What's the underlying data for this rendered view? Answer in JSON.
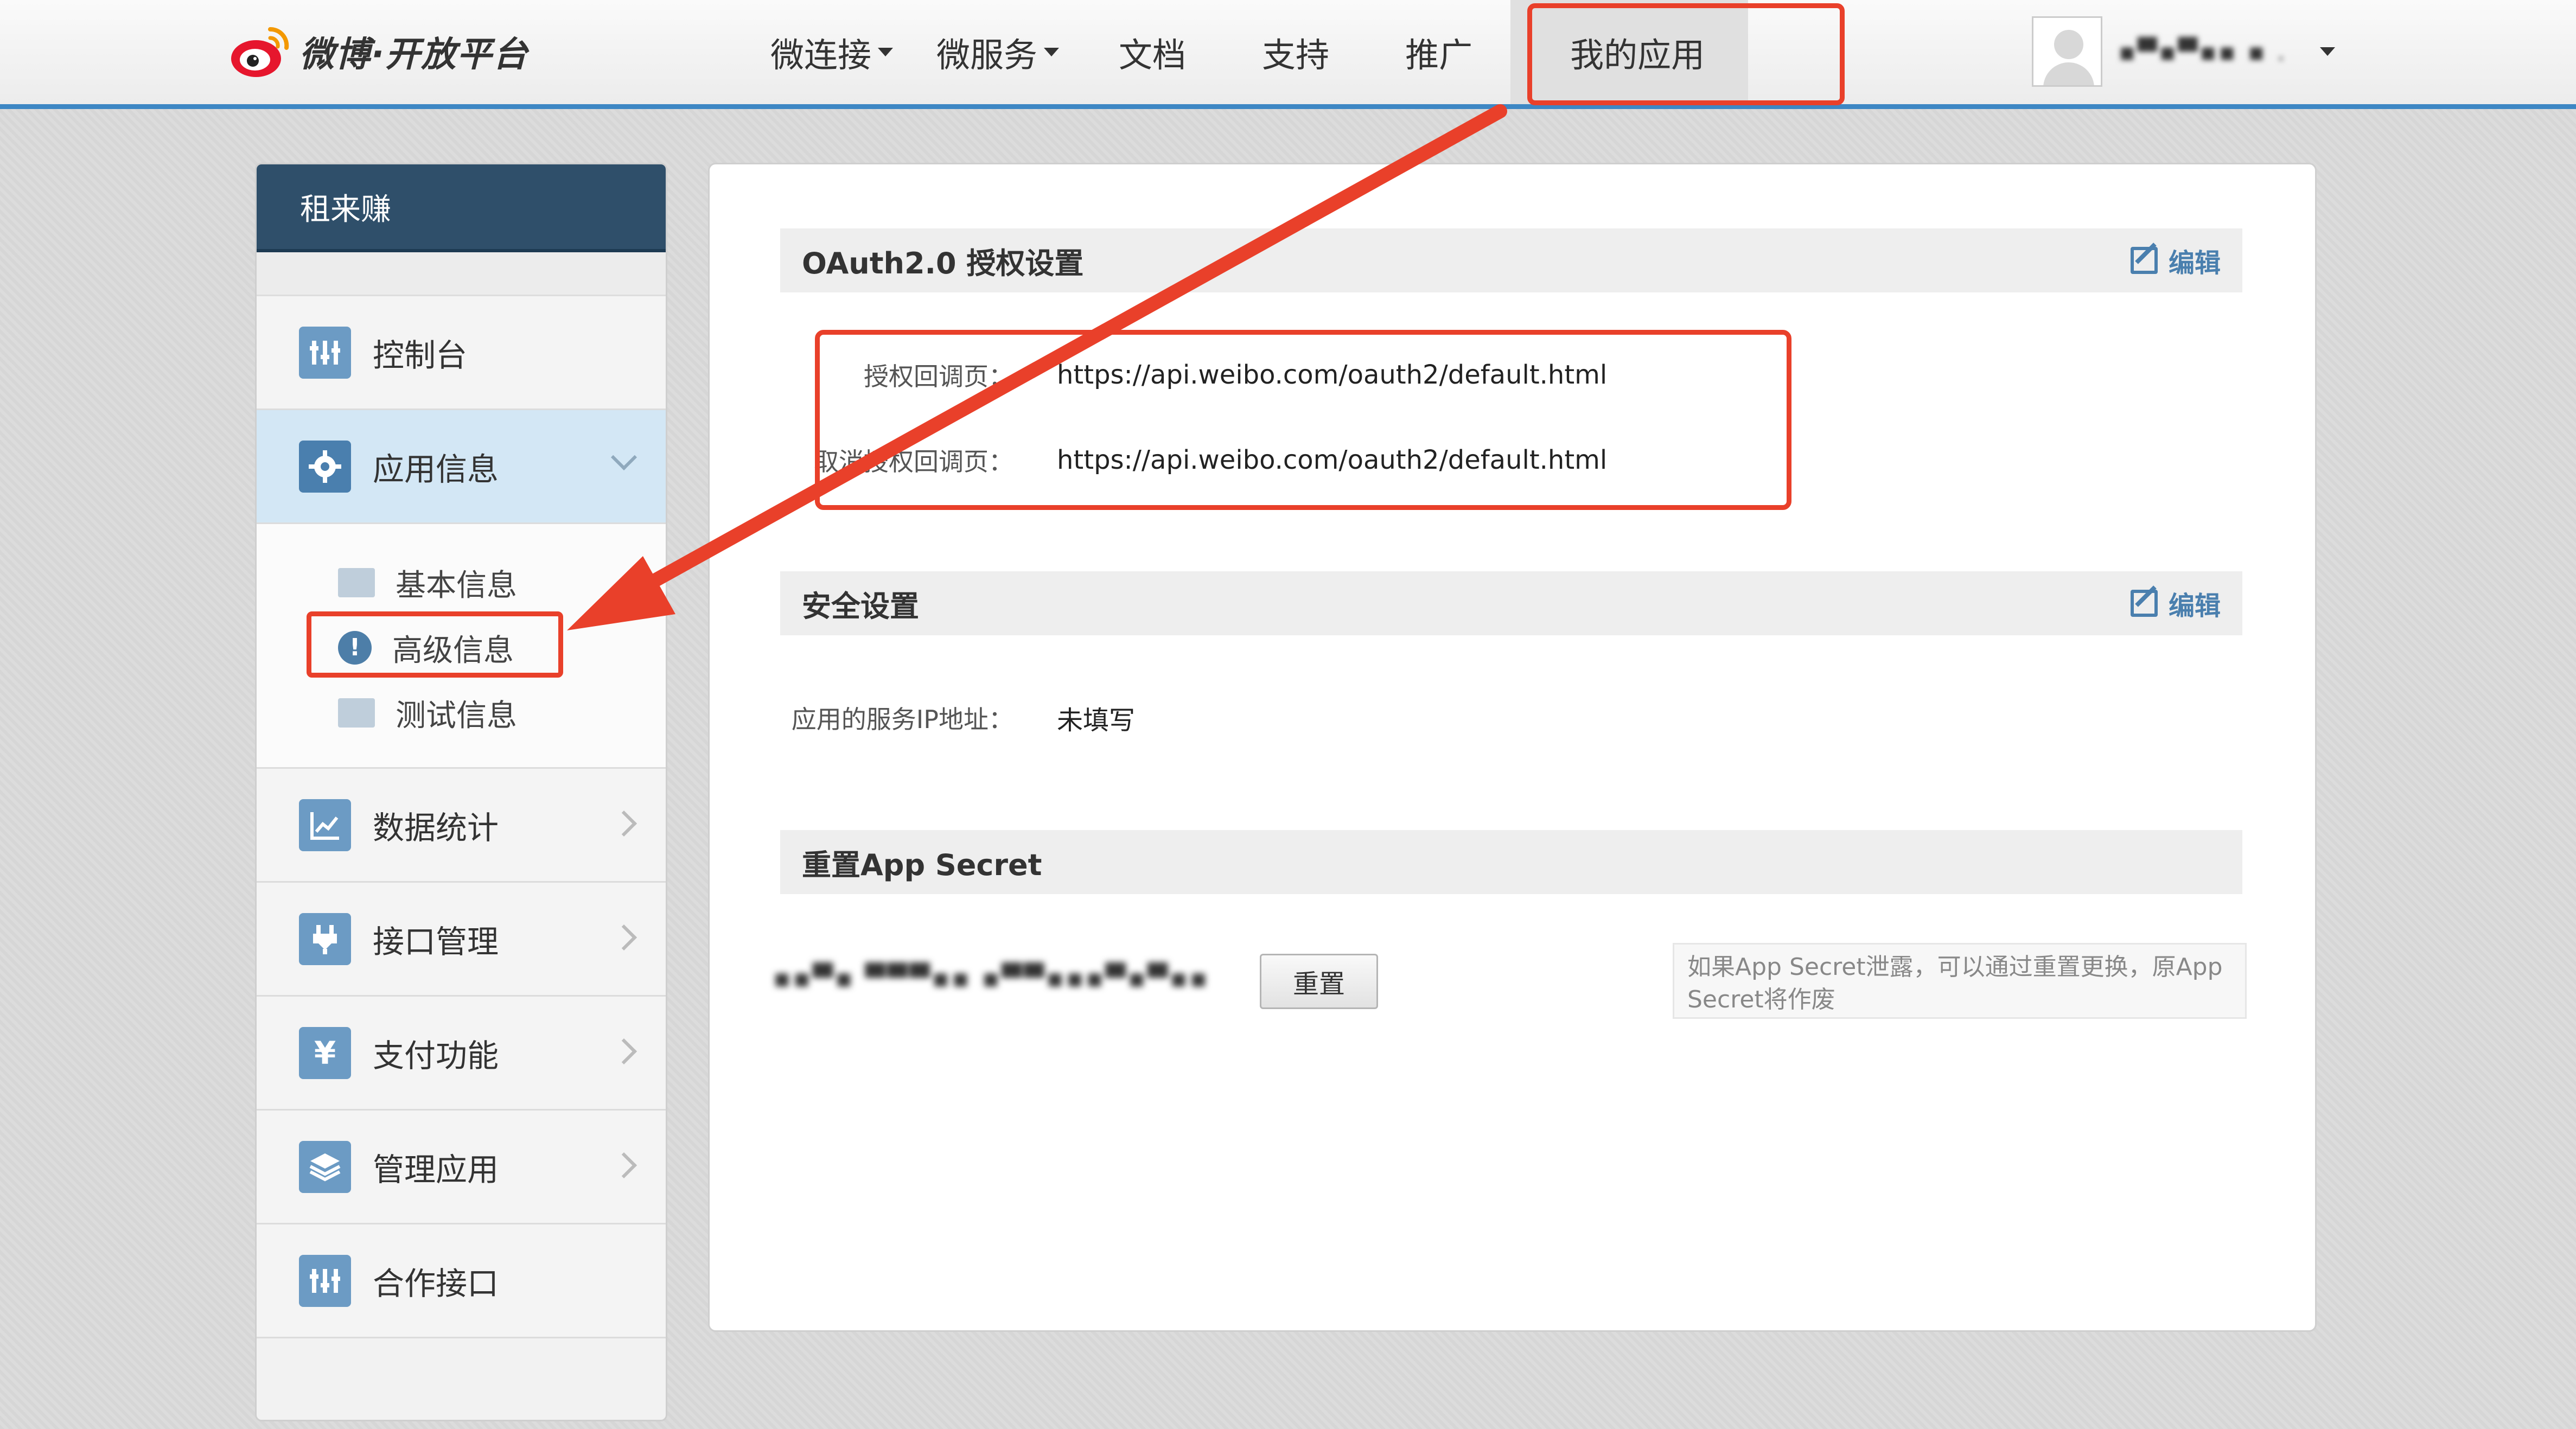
{
  "brand": {
    "name": "微博·开放平台"
  },
  "nav": {
    "items": [
      {
        "label": "微连接",
        "dropdown": true
      },
      {
        "label": "微服务",
        "dropdown": true
      },
      {
        "label": "文档",
        "dropdown": false
      },
      {
        "label": "支持",
        "dropdown": false
      },
      {
        "label": "推广",
        "dropdown": false
      },
      {
        "label": "我的应用",
        "dropdown": false,
        "active": true
      }
    ],
    "user": {
      "name": "▪▀▪▀▪▪ ▪ ."
    }
  },
  "sidebar": {
    "app_name": "租来赚",
    "items": [
      {
        "label": "控制台",
        "icon": "dashboard-icon"
      },
      {
        "label": "应用信息",
        "icon": "gear-icon",
        "active": true,
        "expanded": true
      },
      {
        "label": "数据统计",
        "icon": "chart-icon"
      },
      {
        "label": "接口管理",
        "icon": "plug-icon"
      },
      {
        "label": "支付功能",
        "icon": "yen-icon"
      },
      {
        "label": "管理应用",
        "icon": "layers-icon"
      },
      {
        "label": "合作接口",
        "icon": "dashboard-icon"
      }
    ],
    "subitems": [
      {
        "label": "基本信息",
        "icon": "id-card-icon"
      },
      {
        "label": "高级信息",
        "icon": "exclamation-icon",
        "highlighted": true
      },
      {
        "label": "测试信息",
        "icon": "test-user-icon"
      }
    ]
  },
  "main": {
    "oauth": {
      "title": "OAuth2.0 授权设置",
      "edit_label": "编辑",
      "callback_label": "授权回调页：",
      "callback_value": "https://api.weibo.com/oauth2/default.html",
      "cancel_label": "取消授权回调页：",
      "cancel_value": "https://api.weibo.com/oauth2/default.html"
    },
    "security": {
      "title": "安全设置",
      "edit_label": "编辑",
      "ip_label": "应用的服务IP地址：",
      "ip_value": "未填写"
    },
    "secret": {
      "title": "重置App Secret",
      "value": "▪▪▀▪ ▀▀▀▪▪ ▪▀▀▪▪▪▀▪▀▪▪",
      "reset_label": "重置",
      "hint": "如果App Secret泄露，可以通过重置更换，原App Secret将作废"
    }
  },
  "colors": {
    "accent": "#4a7fae",
    "highlight": "#e9402a",
    "sidebar_header": "#2f4f6a",
    "nav_border": "#3d87c4"
  }
}
